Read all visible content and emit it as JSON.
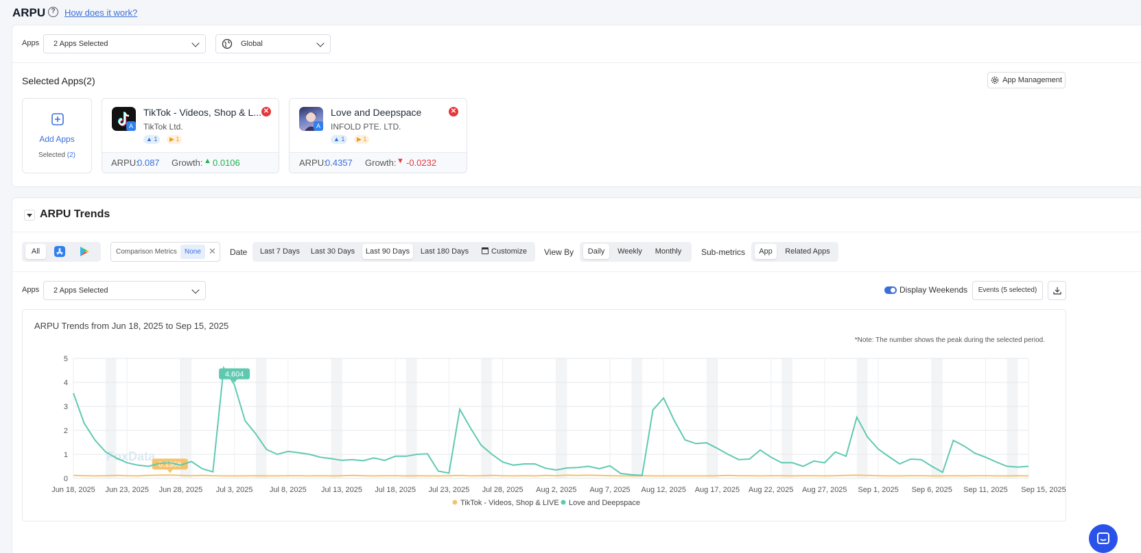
{
  "header": {
    "title": "ARPU",
    "help_icon": "question-circle-icon",
    "help_link": "How does it work?"
  },
  "filters": {
    "apps_label": "Apps",
    "apps_value": "2 Apps Selected",
    "region_value": "Global",
    "region_icon": "globe-icon"
  },
  "selected_apps": {
    "title": "Selected Apps(2)",
    "management_button": "App Management",
    "management_icon": "gear-icon",
    "add": {
      "label": "Add Apps",
      "selected_prefix": "Selected",
      "selected_count": "(2)",
      "icon": "plus-square-icon"
    },
    "apps": [
      {
        "name": "TikTok - Videos, Shop & L...",
        "developer": "TikTok Ltd.",
        "ios_count": "1",
        "android_count": "1",
        "arpu_label": "ARPU:",
        "arpu": "0.087",
        "growth_label": "Growth:",
        "growth": "0.0106",
        "growth_dir": "up"
      },
      {
        "name": "Love and Deepspace",
        "developer": "INFOLD PTE. LTD.",
        "ios_count": "1",
        "android_count": "1",
        "arpu_label": "ARPU:",
        "arpu": "0.4357",
        "growth_label": "Growth:",
        "growth": "-0.0232",
        "growth_dir": "down"
      }
    ]
  },
  "trends": {
    "title": "ARPU Trends",
    "platforms": [
      "All",
      "app-store-icon",
      "google-play-icon"
    ],
    "comparison_label": "Comparison Metrics",
    "comparison_value": "None",
    "date_label": "Date",
    "date_options": [
      "Last 7 Days",
      "Last 30 Days",
      "Last 90 Days",
      "Last 180 Days",
      "Customize"
    ],
    "date_active": "Last 90 Days",
    "view_by_label": "View By",
    "view_by_options": [
      "Daily",
      "Weekly",
      "Monthly"
    ],
    "view_by_active": "Daily",
    "submetrics_label": "Sub-metrics",
    "submetrics_options": [
      "App",
      "Related Apps"
    ],
    "submetrics_active": "App",
    "apps_label": "Apps",
    "apps_value": "2 Apps Selected",
    "display_weekends": "Display Weekends",
    "events_button": "Events  (5 selected)",
    "download_icon": "download-icon",
    "chart_heading": "ARPU Trends from Jun 18, 2025 to Sep 15, 2025",
    "note": "*Note: The number shows the peak during the selected period.",
    "watermark": "FoxData"
  },
  "colors": {
    "accent": "#3b6fd8",
    "tiktok": "#f5c36b",
    "deepspace": "#5fc9b0",
    "up": "#22b14c",
    "down": "#e5383b"
  },
  "chart_data": {
    "type": "line",
    "title": "ARPU Trends from Jun 18, 2025 to Sep 15, 2025",
    "x_ticks": [
      "Jun 18, 2025",
      "Jun 23, 2025",
      "Jun 28, 2025",
      "Jul 3, 2025",
      "Jul 8, 2025",
      "Jul 13, 2025",
      "Jul 18, 2025",
      "Jul 23, 2025",
      "Jul 28, 2025",
      "Aug 2, 2025",
      "Aug 7, 2025",
      "Aug 12, 2025",
      "Aug 17, 2025",
      "Aug 22, 2025",
      "Aug 27, 2025",
      "Sep 1, 2025",
      "Sep 6, 2025",
      "Sep 11, 2025",
      "Sep 15, 2025"
    ],
    "ylim": [
      0,
      5
    ],
    "y_ticks": [
      0,
      1,
      2,
      3,
      4,
      5
    ],
    "weekends_shaded": true,
    "legend_position": "bottom",
    "series": [
      {
        "name": "TikTok - Videos, Shop & LIVE",
        "color": "#f5c36b",
        "peak_label": "0.1366",
        "peak_index": 9,
        "values": [
          0.12,
          0.11,
          0.1,
          0.11,
          0.12,
          0.11,
          0.1,
          0.12,
          0.13,
          0.1366,
          0.12,
          0.11,
          0.12,
          0.11,
          0.1,
          0.1,
          0.1,
          0.11,
          0.1,
          0.1,
          0.11,
          0.11,
          0.1,
          0.11,
          0.1,
          0.11,
          0.12,
          0.11,
          0.1,
          0.11,
          0.11,
          0.1,
          0.11,
          0.1,
          0.1,
          0.11,
          0.12,
          0.1,
          0.11,
          0.12,
          0.11,
          0.1,
          0.11,
          0.1,
          0.12,
          0.11,
          0.13,
          0.12,
          0.13,
          0.12,
          0.11,
          0.1,
          0.1,
          0.11,
          0.1,
          0.1,
          0.1,
          0.1,
          0.1,
          0.1,
          0.11,
          0.12,
          0.11,
          0.11,
          0.1,
          0.11,
          0.11,
          0.1,
          0.11,
          0.11,
          0.1,
          0.11,
          0.12,
          0.13,
          0.12,
          0.11,
          0.1,
          0.1,
          0.11,
          0.11,
          0.1,
          0.1,
          0.11,
          0.1,
          0.11,
          0.11,
          0.1,
          0.1,
          0.11,
          0.1
        ]
      },
      {
        "name": "Love and Deepspace",
        "color": "#5fc9b0",
        "peak_label": "4.604",
        "peak_index": 15,
        "values": [
          3.55,
          2.3,
          1.6,
          1.1,
          0.85,
          0.65,
          0.55,
          0.5,
          0.62,
          0.65,
          0.55,
          0.7,
          0.4,
          0.27,
          4.604,
          3.9,
          2.4,
          1.85,
          1.2,
          1.0,
          1.12,
          1.07,
          1.0,
          0.88,
          0.82,
          0.75,
          0.78,
          0.73,
          0.85,
          0.75,
          0.92,
          0.92,
          1.0,
          1.02,
          0.3,
          0.22,
          2.88,
          2.1,
          1.38,
          1.0,
          0.68,
          0.55,
          0.6,
          0.6,
          0.42,
          0.35,
          0.43,
          0.45,
          0.5,
          0.4,
          0.52,
          0.2,
          0.15,
          0.12,
          2.85,
          3.35,
          2.4,
          1.6,
          1.45,
          1.48,
          1.25,
          1.0,
          0.78,
          0.8,
          1.18,
          0.88,
          0.65,
          0.65,
          0.5,
          0.72,
          0.65,
          1.1,
          0.92,
          2.55,
          1.72,
          1.22,
          0.9,
          0.6,
          0.8,
          0.78,
          0.5,
          0.25,
          1.58,
          1.35,
          1.05,
          0.88,
          0.68,
          0.5,
          0.47,
          0.5
        ]
      }
    ]
  }
}
